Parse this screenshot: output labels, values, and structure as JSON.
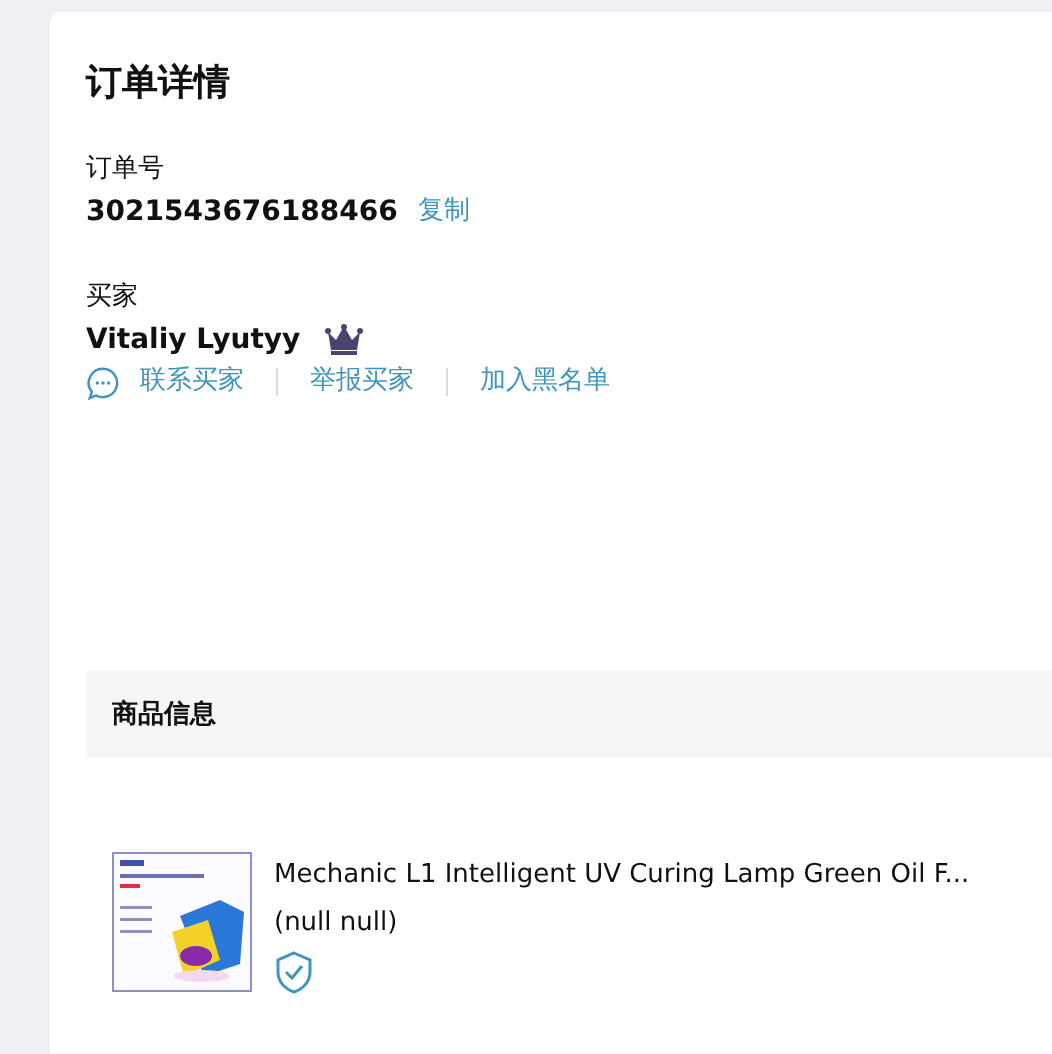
{
  "card": {
    "title": "订单详情"
  },
  "order": {
    "label": "订单号",
    "number": "3021543676188466",
    "copy_link": "复制"
  },
  "buyer": {
    "label": "买家",
    "name": "Vitaliy Lyutyy",
    "actions": [
      "联系买家",
      "举报买家",
      "加入黑名单"
    ]
  },
  "table": {
    "columns": [
      "商品信息"
    ],
    "rows": [
      {
        "title": "Mechanic L1 Intelligent UV Curing Lamp Green Oil F...",
        "variant": "(null null)"
      }
    ]
  }
}
